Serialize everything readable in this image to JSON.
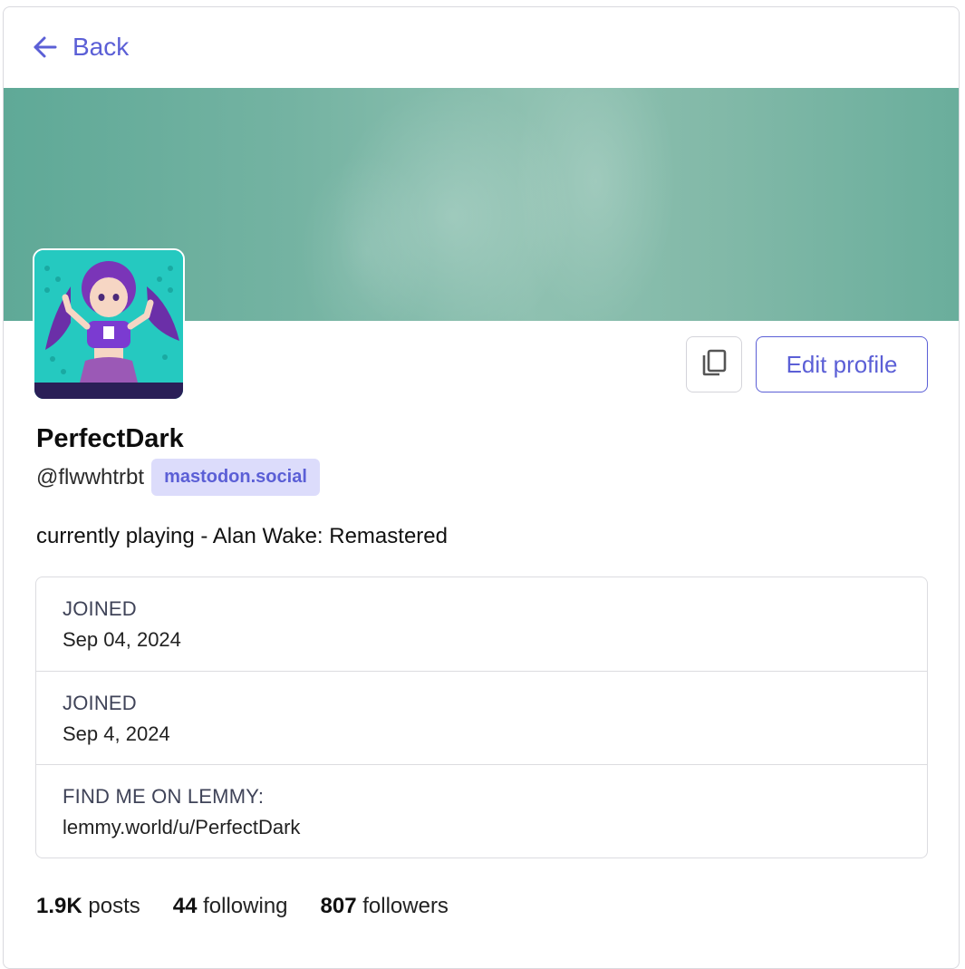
{
  "header": {
    "back_label": "Back",
    "back_icon": "arrow-left-icon"
  },
  "profile": {
    "display_name": "PerfectDark",
    "handle": "@flwwhtrbt",
    "domain": "mastodon.social",
    "bio": "currently playing - Alan Wake: Remastered"
  },
  "actions": {
    "copy_icon": "copy-icon",
    "edit_label": "Edit profile"
  },
  "fields": [
    {
      "label": "JOINED",
      "value": "Sep 04, 2024"
    },
    {
      "label": "JOINED",
      "value": "Sep 4, 2024"
    },
    {
      "label": "FIND ME ON LEMMY:",
      "value": "lemmy.world/u/PerfectDark"
    }
  ],
  "stats": {
    "posts_count": "1.9K",
    "posts_label": "posts",
    "following_count": "44",
    "following_label": "following",
    "followers_count": "807",
    "followers_label": "followers"
  },
  "colors": {
    "accent": "#5b5fd6",
    "badge_bg": "#dcdcfb",
    "banner": "#7fb8a6"
  }
}
